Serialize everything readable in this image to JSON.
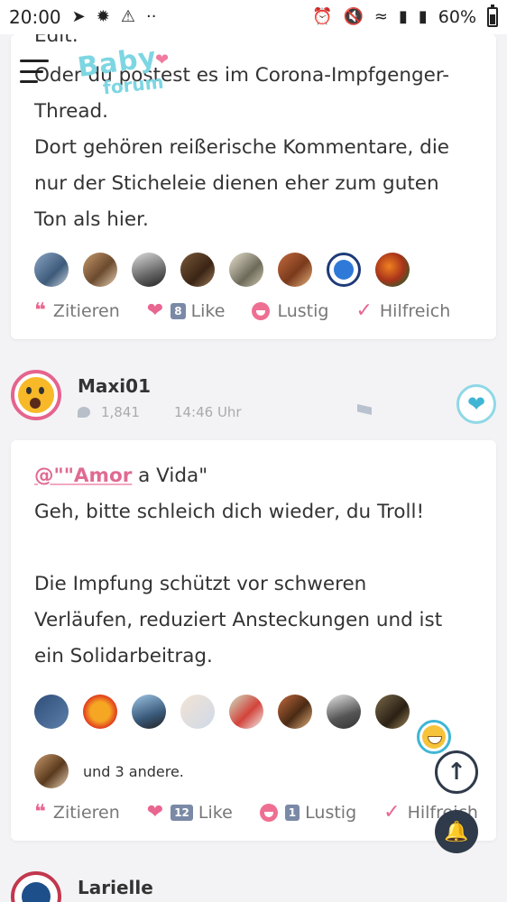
{
  "status_bar": {
    "time": "20:00",
    "battery_percent": "60%",
    "battery_level": 0.6,
    "left_icons": [
      "telegram-icon",
      "fan-icon",
      "warning-icon",
      "more-dots-icon"
    ],
    "right_icons": [
      "alarm-icon",
      "mute-icon",
      "wifi-icon",
      "signal-icon",
      "signal-icon"
    ]
  },
  "header": {
    "logo_word1": "Baby",
    "logo_word2": "forum"
  },
  "post1": {
    "lines": [
      "Edit:",
      "Oder du postest es im Corona-Impfgenger-",
      "Thread.",
      "Dort gehören reißerische Kommentare, die",
      "nur der Sticheleie dienen eher zum guten",
      "Ton als hier."
    ],
    "reactions": {
      "quote_label": "Zitieren",
      "like_count": "8",
      "like_label": "Like",
      "funny_label": "Lustig",
      "helpful_label": "Hilfreich"
    }
  },
  "post2": {
    "username": "Maxi01",
    "post_count": "1,841",
    "time": "14:46 Uhr",
    "mention": "@\"\"Amor",
    "mention_rest": " a Vida\"",
    "lines": [
      "Geh, bitte schleich dich wieder, du Troll!",
      "",
      "Die Impfung schützt vor schweren",
      "Verläufen, reduziert Ansteckungen und ist",
      "ein Solidarbeitrag."
    ],
    "and_more": "und 3 andere.",
    "reactions": {
      "quote_label": "Zitieren",
      "like_count": "12",
      "like_label": "Like",
      "funny_count": "1",
      "funny_label": "Lustig",
      "helpful_label": "Hilfreich"
    }
  },
  "post3": {
    "username": "Larielle"
  },
  "colors": {
    "accent_pink": "#e8668f",
    "accent_teal": "#3fb6d4",
    "dark_button": "#2f3a4a"
  }
}
